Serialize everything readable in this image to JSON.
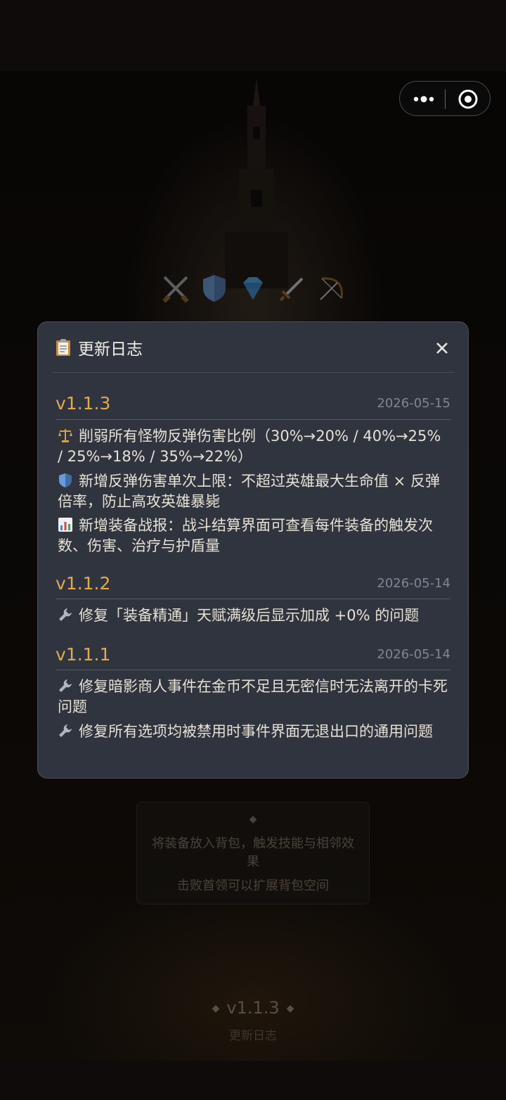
{
  "capsule": {
    "more_icon": "more-dots-icon",
    "target_icon": "target-icon"
  },
  "background": {
    "icons": [
      "crossed-swords-icon",
      "shield-icon",
      "diamond-icon",
      "dagger-icon",
      "bow-icon"
    ],
    "tip": {
      "diamond": "◆",
      "line1": "将装备放入背包，触发技能与相邻效果",
      "line2": "击败首领可以扩展背包空间"
    },
    "footer": {
      "version": "v1.1.3",
      "diamond": "◆",
      "changelog_link": "更新日志"
    }
  },
  "modal": {
    "title": "更新日志",
    "title_icon": "clipboard-icon",
    "close_icon": "close-icon",
    "versions": [
      {
        "version": "v1.1.3",
        "date": "2026-05-15",
        "entries": [
          {
            "icon": "balance-scale-icon",
            "text": "削弱所有怪物反弹伤害比例（30%→20% / 40%→25% / 25%→18% / 35%→22%）"
          },
          {
            "icon": "shield-icon",
            "text": "新增反弹伤害单次上限：不超过英雄最大生命值 × 反弹倍率，防止高攻英雄暴毙"
          },
          {
            "icon": "bar-chart-icon",
            "text": "新增装备战报：战斗结算界面可查看每件装备的触发次数、伤害、治疗与护盾量"
          }
        ]
      },
      {
        "version": "v1.1.2",
        "date": "2026-05-14",
        "entries": [
          {
            "icon": "wrench-icon",
            "text": "修复「装备精通」天赋满级后显示加成 +0% 的问题"
          }
        ]
      },
      {
        "version": "v1.1.1",
        "date": "2026-05-14",
        "entries": [
          {
            "icon": "wrench-icon",
            "text": "修复暗影商人事件在金币不足且无密信时无法离开的卡死问题"
          },
          {
            "icon": "wrench-icon",
            "text": "修复所有选项均被禁用时事件界面无退出口的通用问题"
          }
        ]
      }
    ]
  }
}
